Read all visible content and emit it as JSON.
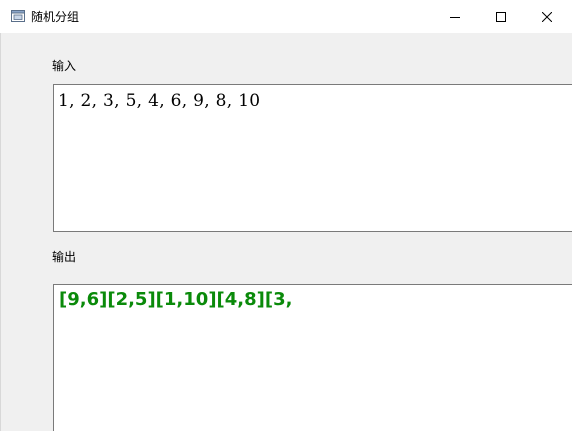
{
  "window": {
    "title": "随机分组",
    "controls": [
      "minimize",
      "maximize",
      "close"
    ]
  },
  "input": {
    "label": "输入",
    "value": "1, 2, 3, 5, 4, 6, 9, 8, 10"
  },
  "output": {
    "label": "输出",
    "value": "[9,6][2,5][1,10][4,8][3,",
    "text_color": "#0a8a0a"
  },
  "icons": {
    "app": "window-app-icon",
    "minimize": "minimize-icon",
    "maximize": "maximize-icon",
    "close": "close-icon"
  }
}
